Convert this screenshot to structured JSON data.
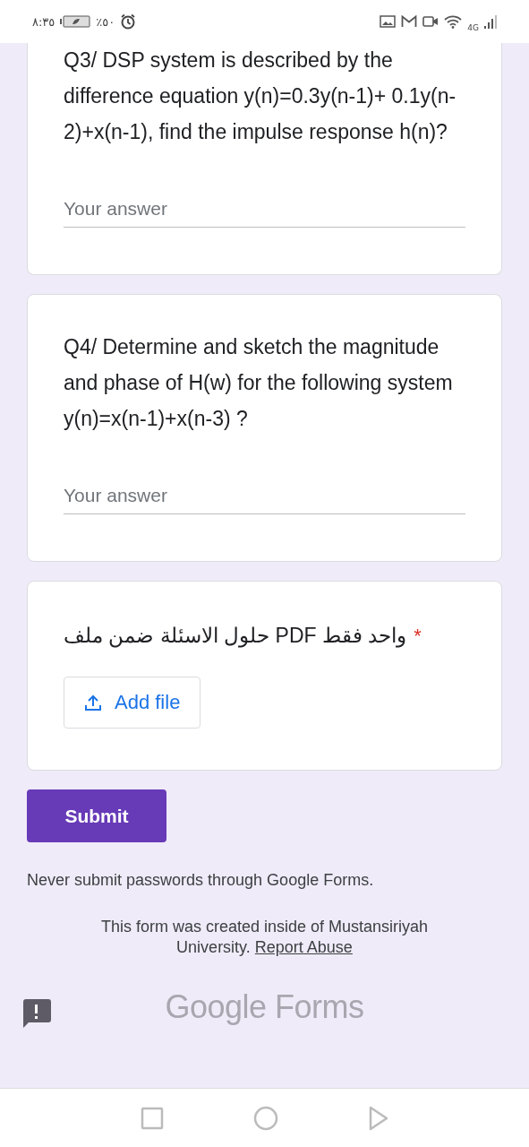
{
  "status_bar": {
    "time": "٨:٣٥",
    "battery": "٪٥٠",
    "network": "4G"
  },
  "questions": [
    {
      "kind": "text",
      "title": "Q3/ DSP system is described by the difference equation y(n)=0.3y(n-1)+ 0.1y(n-2)+x(n-1), find the impulse response h(n)?",
      "placeholder": "Your answer",
      "required": false
    },
    {
      "kind": "text",
      "title": "Q4/ Determine and sketch the magnitude and phase of H(w) for the following system y(n)=x(n-1)+x(n-3) ?",
      "placeholder": "Your answer",
      "required": false
    },
    {
      "kind": "file",
      "title": "حلول الاسئلة ضمن ملف PDF واحد فقط",
      "required": true,
      "required_mark": "*",
      "button": "Add file"
    }
  ],
  "submit": "Submit",
  "warning": "Never submit passwords through Google Forms.",
  "footer": {
    "text": "This form was created inside of Mustansiriyah University.",
    "link": "Report Abuse"
  },
  "logo": {
    "first": "Google",
    "second": "Forms"
  }
}
